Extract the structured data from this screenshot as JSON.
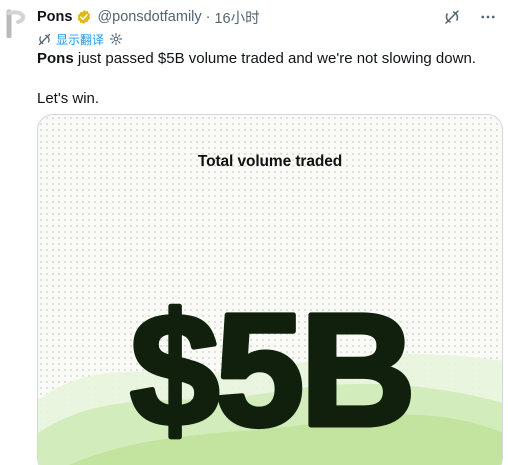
{
  "post": {
    "author_name": "Pons",
    "handle": "@ponsdotfamily",
    "separator": "·",
    "time": "16小时",
    "translate_label": "显示翻译",
    "text_bold": "Pons",
    "text_rest": " just passed $5B volume traded and we're not slowing down.",
    "text_line2": "Let's win.",
    "icons": {
      "avatar": "pons-logo-icon",
      "verified": "verified-badge-icon",
      "grok": "grok-icon",
      "more": "more-icon",
      "translate": "translate-icon",
      "settings": "gear-icon"
    }
  },
  "media": {
    "caption": "Total volume traded",
    "headline": "$5B",
    "colors": {
      "headline": "#10200c",
      "wave_light": "#e6f3d8",
      "wave_mid": "#c9e8ad",
      "background": "#fafbf7"
    }
  }
}
